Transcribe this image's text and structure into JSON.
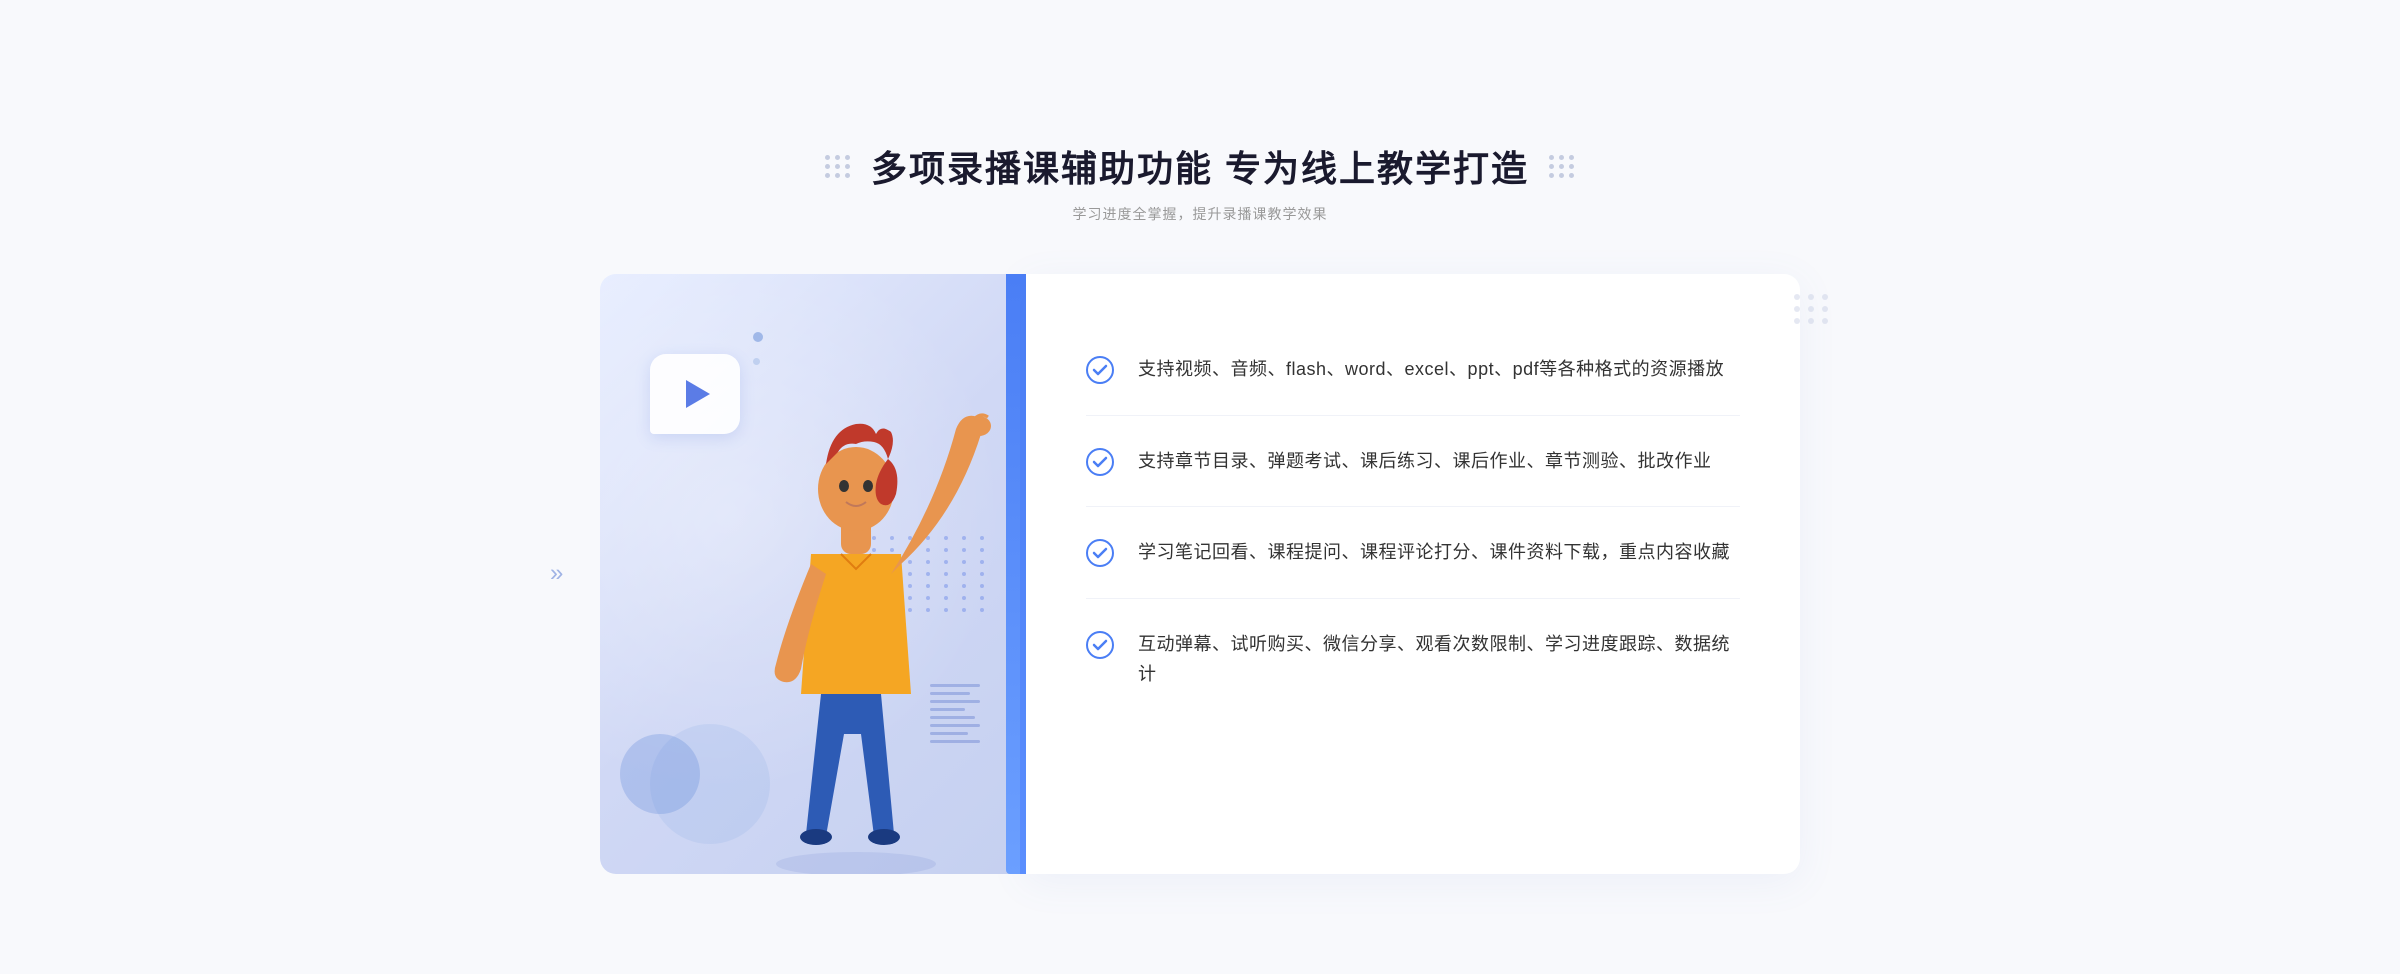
{
  "header": {
    "title": "多项录播课辅助功能 专为线上教学打造",
    "subtitle": "学习进度全掌握，提升录播课教学效果"
  },
  "features": [
    {
      "id": 1,
      "text": "支持视频、音频、flash、word、excel、ppt、pdf等各种格式的资源播放"
    },
    {
      "id": 2,
      "text": "支持章节目录、弹题考试、课后练习、课后作业、章节测验、批改作业"
    },
    {
      "id": 3,
      "text": "学习笔记回看、课程提问、课程评论打分、课件资料下载，重点内容收藏"
    },
    {
      "id": 4,
      "text": "互动弹幕、试听购买、微信分享、观看次数限制、学习进度跟踪、数据统计"
    }
  ],
  "colors": {
    "primary": "#4a7ef5",
    "title_color": "#1a1a2e",
    "subtitle_color": "#999999",
    "text_color": "#333333",
    "check_color": "#4a7ef5"
  },
  "icons": {
    "play": "▶",
    "chevron_left": "»",
    "check": "check-circle"
  }
}
